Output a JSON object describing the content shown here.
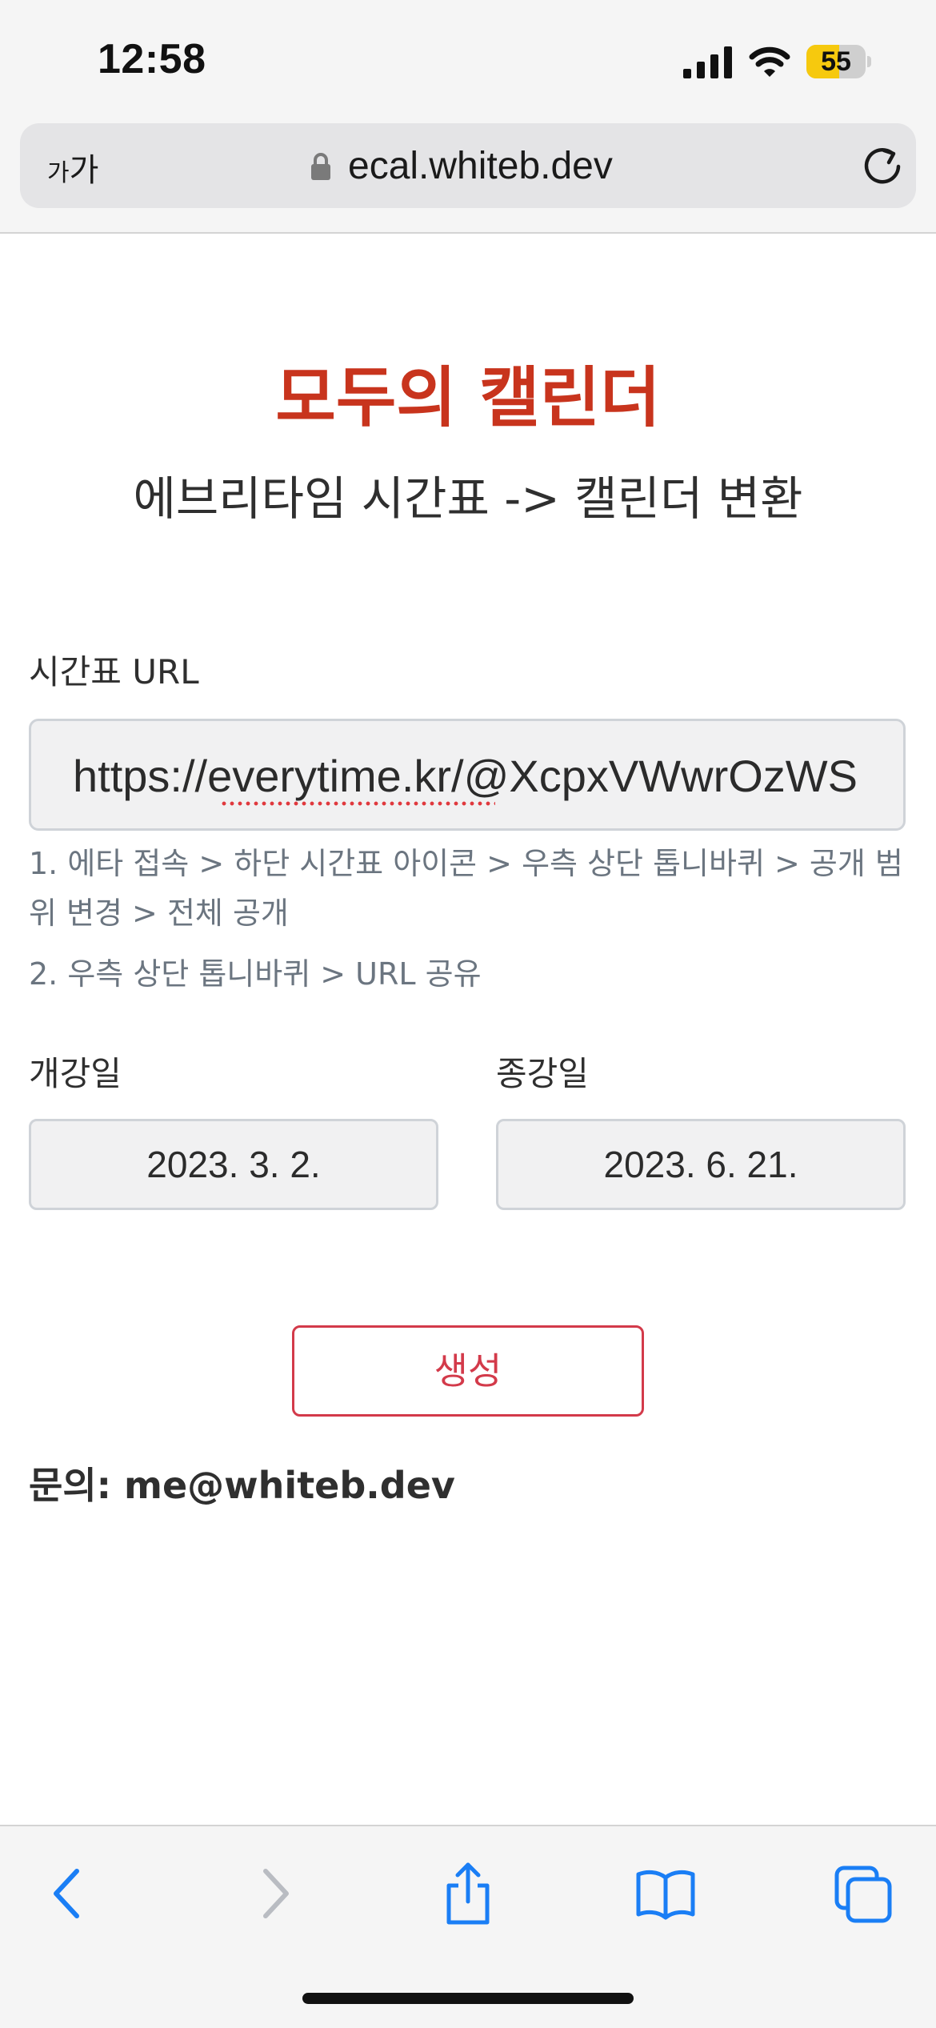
{
  "status_bar": {
    "time": "12:58",
    "battery_level": "55",
    "battery_fraction": 0.55
  },
  "browser": {
    "reader_button_small": "가",
    "reader_button_large": "가",
    "url": "ecal.whiteb.dev"
  },
  "page": {
    "title": "모두의 캘린더",
    "subtitle": "에브리타임 시간표 -> 캘린더 변환",
    "timetable_url_label": "시간표 URL",
    "timetable_url_value": "https://everytime.kr/@XcpxVWwrOzWS",
    "help_step1": "1. 에타 접속 > 하단 시간표 아이콘 > 우측 상단 톱니바퀴 > 공개 범위 변경 > 전체 공개",
    "help_step2": "2. 우측 상단 톱니바퀴 > URL 공유",
    "start_date_label": "개강일",
    "start_date_value": "2023. 3. 2.",
    "end_date_label": "종강일",
    "end_date_value": "2023. 6. 21.",
    "generate_button": "생성",
    "contact": "문의: me@whiteb.dev"
  },
  "colors": {
    "title": "#c8341d",
    "button": "#d33a4a",
    "toolbar_icons": "#1a7ef5",
    "battery": "#f6c90e"
  },
  "icons": {
    "signal": "cellular-signal-icon",
    "wifi": "wifi-icon",
    "lock": "lock-icon",
    "reload": "reload-icon",
    "back": "chevron-left-icon",
    "forward": "chevron-right-icon",
    "share": "share-icon",
    "bookmarks": "open-book-icon",
    "tabs": "tabs-icon"
  }
}
